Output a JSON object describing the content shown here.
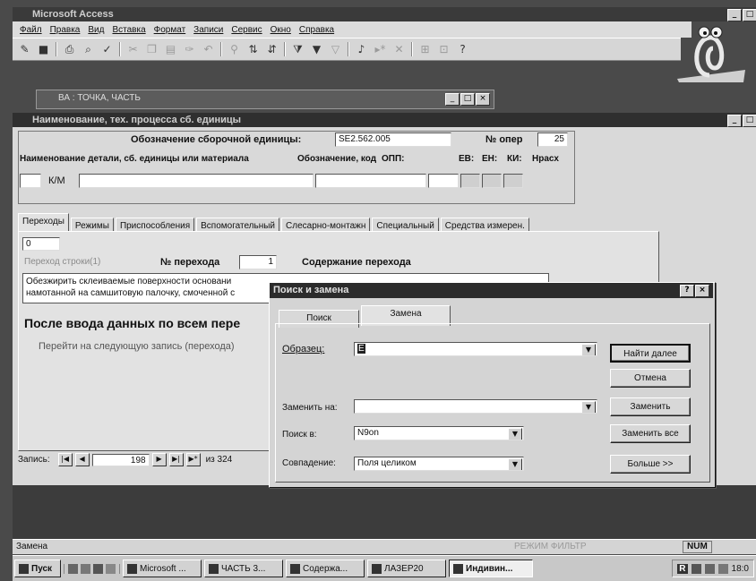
{
  "app": {
    "title": "Microsoft Access",
    "menu": [
      "Файл",
      "Правка",
      "Вид",
      "Вставка",
      "Формат",
      "Записи",
      "Сервис",
      "Окно",
      "Справка"
    ]
  },
  "bg_window": {
    "title": "ВА : ТОЧКА, ЧАСТЬ"
  },
  "form": {
    "title": "Наименование, тех. процесса сб. единицы",
    "assembly_label": "Обозначение сборочной единицы:",
    "assembly_value": "SE2.562.005",
    "op_label": "№ опер",
    "op_value": "25",
    "detail_header": "Наименование детали, сб. единицы или материала",
    "code_header": "Обозначение, код",
    "opp_header": "ОПП:",
    "ev_header": "ЕВ:",
    "en_header": "ЕН:",
    "ki_header": "КИ:",
    "nrash_header": "Нрасх",
    "km_label": "К/М",
    "tabs": [
      "Переходы",
      "Режимы",
      "Приспособления",
      "Вспомогательный",
      "Слесарно-монтажн",
      "Специальный",
      "Средства измерен."
    ],
    "active_tab": 0,
    "zero_value": "0",
    "side_label": "Переход строки(1)",
    "transition_no_label": "№ перехода",
    "transition_no_value": "1",
    "content_label": "Содержание перехода",
    "content_text": "Обезжирить склеиваемые поверхности основани\nнамотанной на самшитовую палочку, смоченной с",
    "after_input": "После ввода данных по всем пере",
    "next_record": "Перейти на следующую запись (перехода)",
    "record_label": "Запись:",
    "record_value": "198",
    "record_total": "из 324"
  },
  "dialog": {
    "title": "Поиск и замена",
    "help": "?",
    "close": "×",
    "tabs": [
      "Поиск",
      "Замена"
    ],
    "active_tab": 1,
    "find_label": "Образец:",
    "find_value": "Е",
    "replace_label": "Заменить на:",
    "replace_value": "",
    "lookin_label": "Поиск в:",
    "lookin_value": "N9on",
    "match_label": "Совпадение:",
    "match_value": "Поля целиком",
    "btn_find_next": "Найти далее",
    "btn_cancel": "Отмена",
    "btn_replace": "Заменить",
    "btn_replace_all": "Заменить все",
    "btn_more": "Больше >>"
  },
  "status": {
    "left": "Замена",
    "right_num": "NUM",
    "right_mid": "РЕЖИМ ФИЛЬТР"
  },
  "taskbar": {
    "start": "Пуск",
    "items": [
      "Microsoft ...",
      "ЧАСТЬ 3...",
      "Содержа...",
      "ЛАЗЕР20",
      "Индивин..."
    ],
    "active_item": 4,
    "lang": "R",
    "clock": "18:0"
  }
}
